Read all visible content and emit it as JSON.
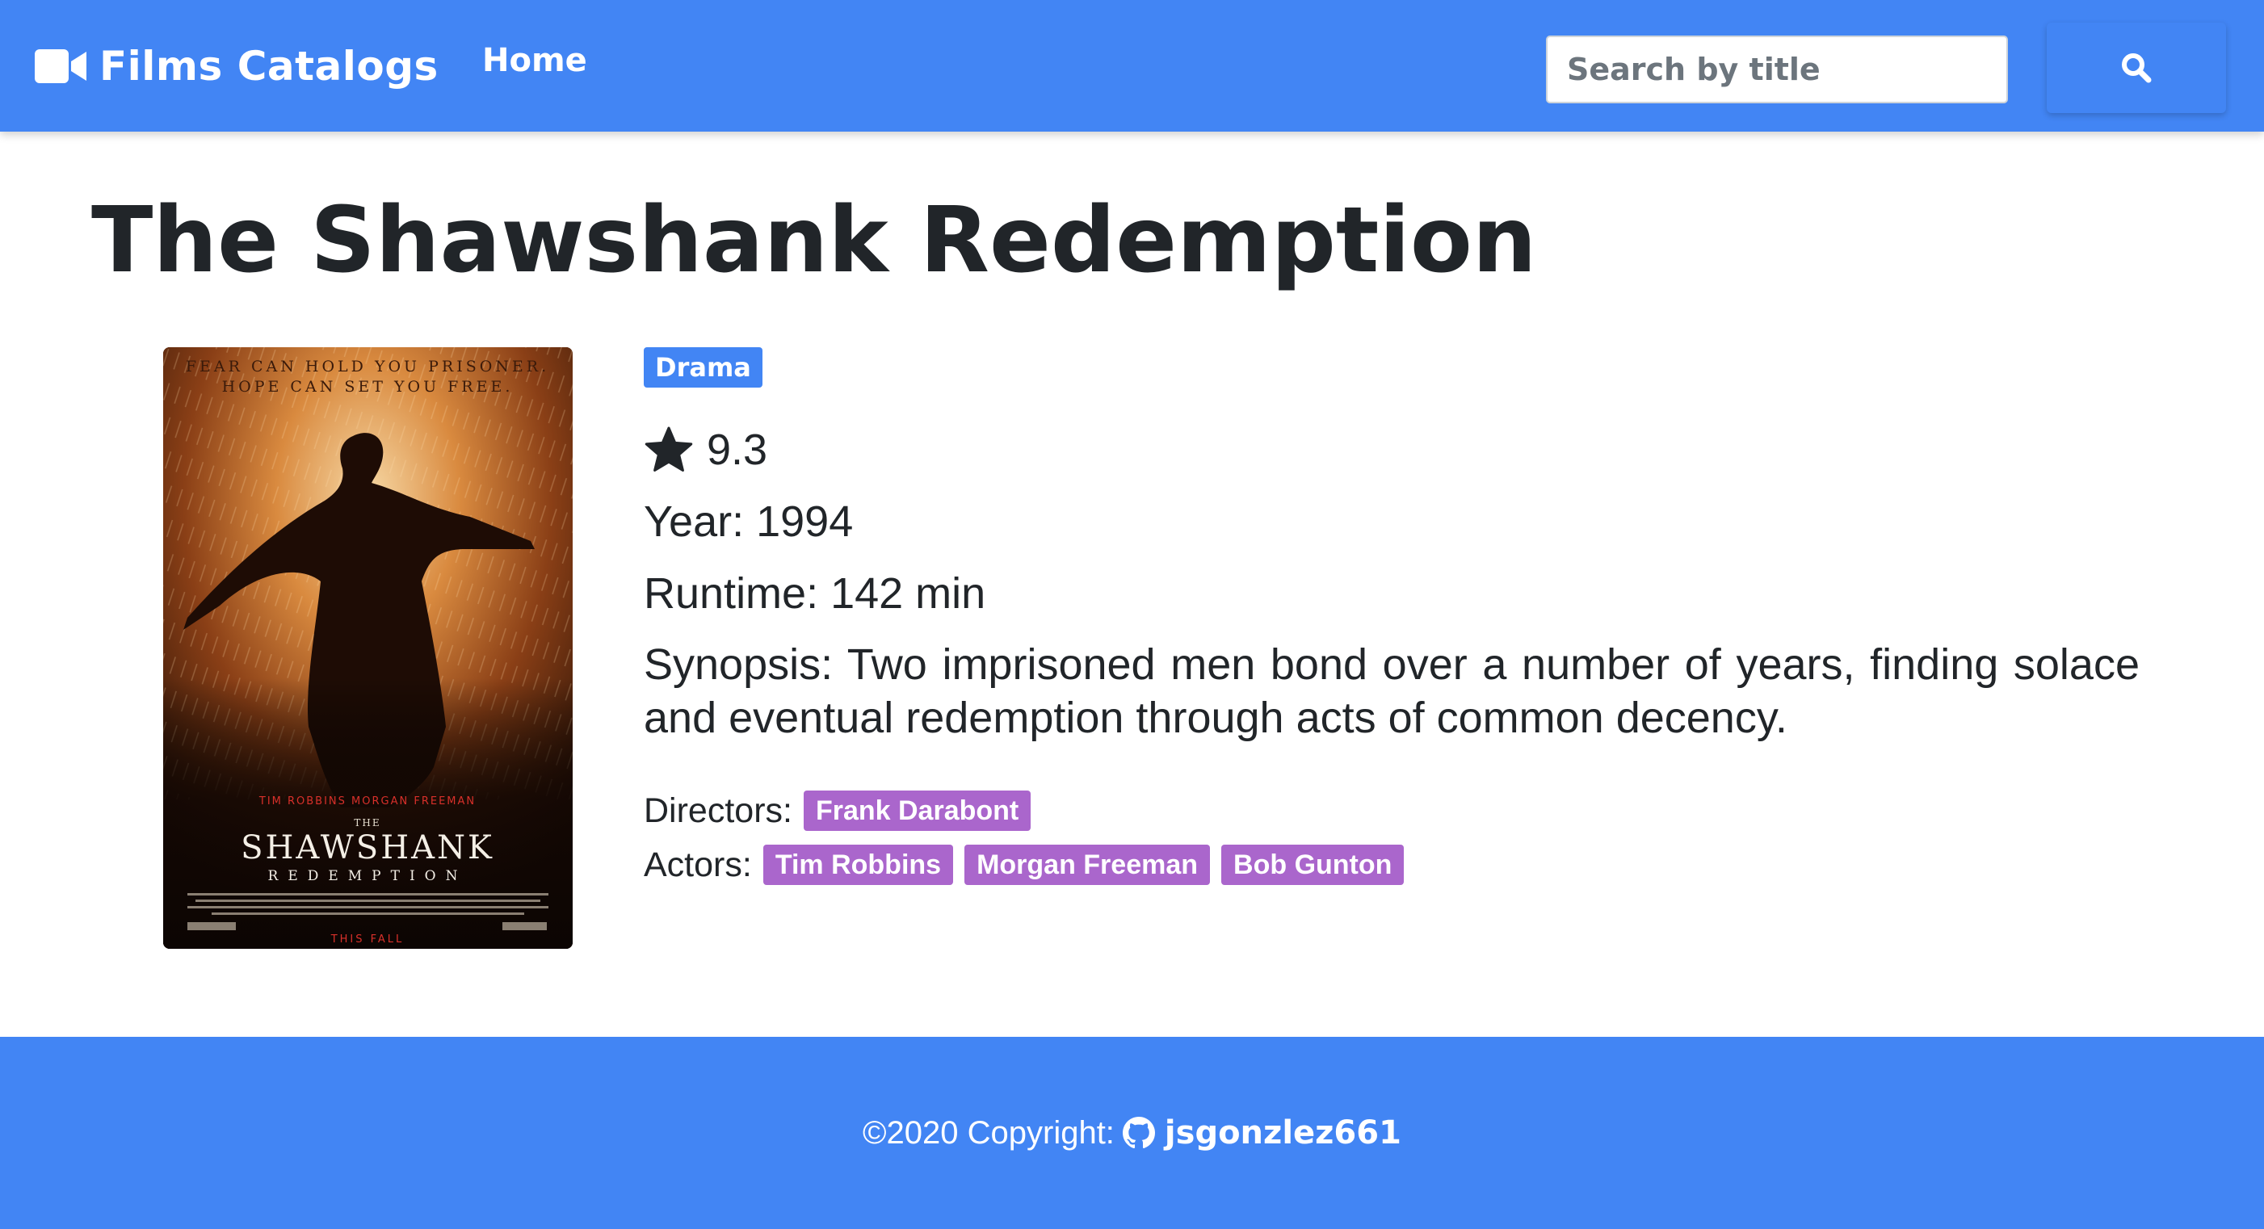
{
  "navbar": {
    "brand": "Films Catalogs",
    "brand_icon": "video-camera-icon",
    "home_label": "Home",
    "search_placeholder": "Search by title",
    "search_value": "",
    "search_icon": "search-icon",
    "background_color": "#4285f4"
  },
  "film": {
    "title": "The Shawshank Redemption",
    "genre": "Drama",
    "rating": "9.3",
    "rating_icon": "star-icon",
    "year_line": "Year: 1994",
    "runtime_line": "Runtime: 142 min",
    "synopsis_line": "Synopsis: Two imprisoned men bond over a number of years, finding solace and eventual redemption through acts of common decency.",
    "directors_label": "Directors:",
    "directors": [
      "Frank Darabont"
    ],
    "actors_label": "Actors:",
    "actors": [
      "Tim Robbins",
      "Morgan Freeman",
      "Bob Gunton"
    ],
    "poster": {
      "tagline_1": "FEAR CAN HOLD YOU PRISONER.",
      "tagline_2": "HOPE CAN SET YOU FREE.",
      "credits": "TIM ROBBINS     MORGAN FREEMAN",
      "the": "THE",
      "title_1": "SHAWSHANK",
      "title_2": "REDEMPTION",
      "release": "THIS FALL"
    },
    "genre_badge_color": "#4285f4",
    "person_badge_color": "#aa66cc"
  },
  "footer": {
    "copyright": "©2020 Copyright:",
    "github_icon": "github-icon",
    "username": "jsgonzlez661"
  }
}
